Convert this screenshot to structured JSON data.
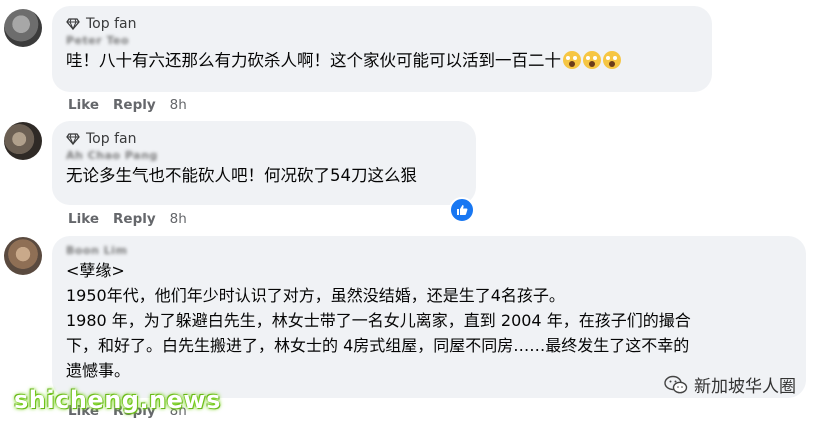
{
  "comments": [
    {
      "badge": "Top fan",
      "author": "Peter Teo",
      "text": "哇！八十有六还那么有力砍杀人啊！这个家伙可能可以活到一百二十",
      "emojis": [
        "scream-emoji",
        "scream-emoji",
        "scream-emoji"
      ],
      "like": "Like",
      "reply": "Reply",
      "time": "8h"
    },
    {
      "badge": "Top fan",
      "author": "Ah Chao Pang",
      "text": "无论多生气也不能砍人吧！何况砍了54刀这么狠",
      "reaction": "like-reaction-icon",
      "like": "Like",
      "reply": "Reply",
      "time": "8h"
    },
    {
      "author": "Boon Lim",
      "lines": [
        "<孽缘>",
        "1950年代，他们年少时认识了对方，虽然没结婚，还是生了4名孩子。",
        "1980 年，为了躲避白先生，林女士带了一名女儿离家，直到 2004 年，在孩子们的撮合",
        "下，和好了。白先生搬进了，林女士的 4房式组屋，同屋不同房……最终发生了这不幸的",
        "遗憾事。"
      ],
      "like": "Like",
      "reply": "Reply",
      "time": "8h"
    }
  ],
  "watermark": {
    "channel": "新加坡华人圈",
    "site": "shicheng.news",
    "icon": "wechat-icon"
  },
  "colors": {
    "bubble": "#f0f2f5",
    "meta": "#65676b",
    "like_blue": "#1877f2",
    "site_glow": "#7cd322"
  }
}
